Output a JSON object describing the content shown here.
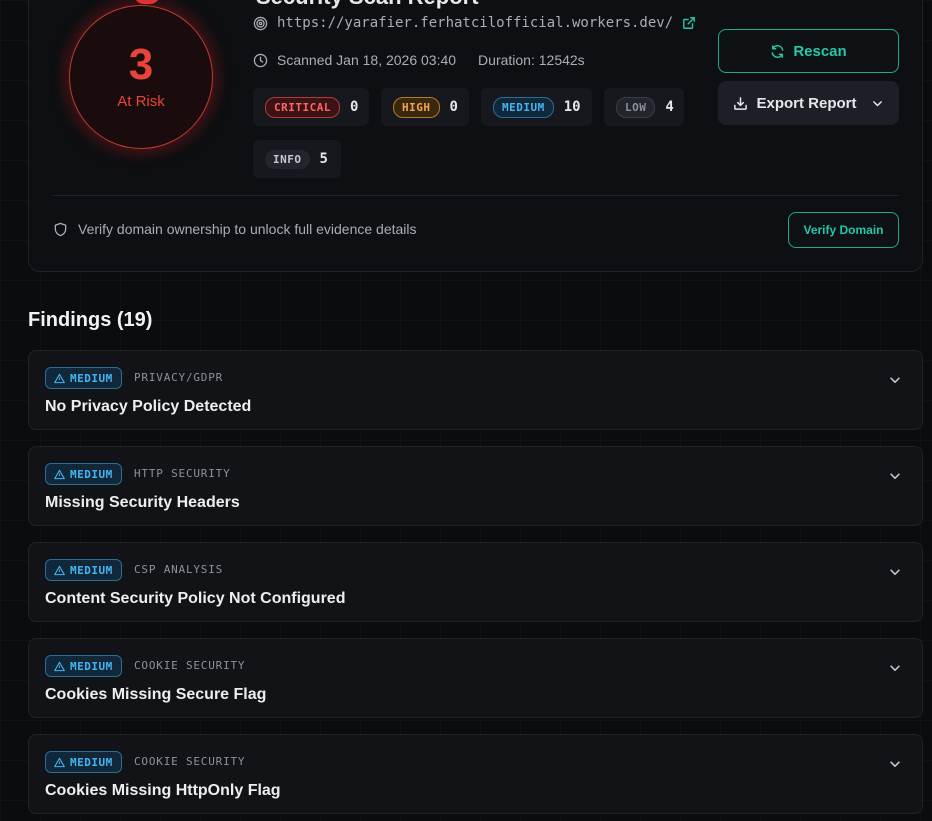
{
  "header": {
    "title_fragment": "Security Scan Report"
  },
  "score": {
    "value": "3",
    "label": "At Risk",
    "color": "#e8443a"
  },
  "scan": {
    "url": "https://yarafier.ferhatcilofficial.workers.dev/",
    "scanned": "Scanned Jan 18, 2026 03:40",
    "duration": "Duration: 12542s"
  },
  "severity_counts": [
    {
      "label": "CRITICAL",
      "count": "0"
    },
    {
      "label": "HIGH",
      "count": "0"
    },
    {
      "label": "MEDIUM",
      "count": "10"
    },
    {
      "label": "LOW",
      "count": "4"
    },
    {
      "label": "INFO",
      "count": "5"
    }
  ],
  "actions": {
    "rescan": "Rescan",
    "export": "Export Report",
    "verify_note": "Verify domain ownership to unlock full evidence details",
    "verify_button": "Verify Domain"
  },
  "findings_heading": "Findings (19)",
  "findings": [
    {
      "severity": "MEDIUM",
      "category": "PRIVACY/GDPR",
      "title": "No Privacy Policy Detected"
    },
    {
      "severity": "MEDIUM",
      "category": "HTTP SECURITY",
      "title": "Missing Security Headers"
    },
    {
      "severity": "MEDIUM",
      "category": "CSP ANALYSIS",
      "title": "Content Security Policy Not Configured"
    },
    {
      "severity": "MEDIUM",
      "category": "COOKIE SECURITY",
      "title": "Cookies Missing Secure Flag"
    },
    {
      "severity": "MEDIUM",
      "category": "COOKIE SECURITY",
      "title": "Cookies Missing HttpOnly Flag"
    }
  ],
  "colors": {
    "accent": "#24c7a8",
    "critical": "#ff6464",
    "high": "#f0a84a",
    "medium": "#47b4f0",
    "background": "#0b0c0e"
  }
}
